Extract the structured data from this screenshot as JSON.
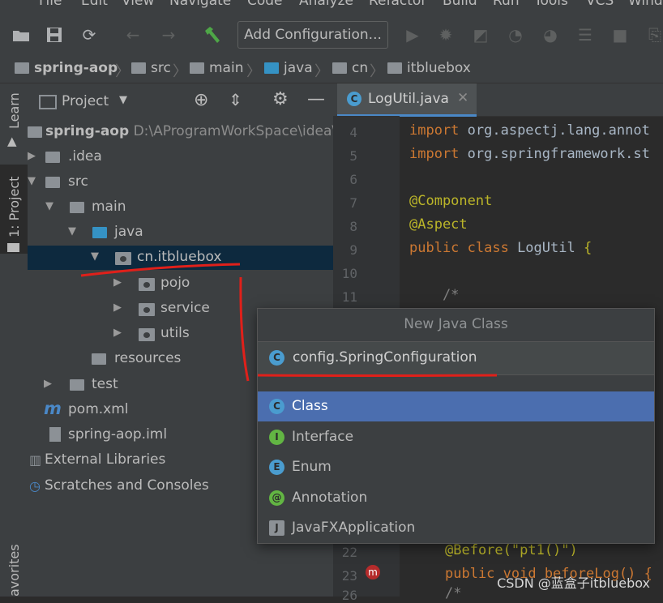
{
  "menu": [
    "File",
    "Edit",
    "View",
    "Navigate",
    "Code",
    "Analyze",
    "Refactor",
    "Build",
    "Run",
    "Tools",
    "VCS",
    "Wind"
  ],
  "toolbar": {
    "add_configuration": "Add Configuration..."
  },
  "breadcrumb": [
    "spring-aop",
    "src",
    "main",
    "java",
    "cn",
    "itbluebox"
  ],
  "stripe": {
    "learn": "Learn",
    "project": "1: Project",
    "favorites": "avorites"
  },
  "project_panel": {
    "title": "Project",
    "tree": [
      {
        "label": "spring-aop",
        "extra": "D:\\AProgramWorkSpace\\idea\\s"
      },
      {
        "label": ".idea"
      },
      {
        "label": "src"
      },
      {
        "label": "main"
      },
      {
        "label": "java"
      },
      {
        "label": "cn.itbluebox"
      },
      {
        "label": "pojo"
      },
      {
        "label": "service"
      },
      {
        "label": "utils"
      },
      {
        "label": "resources"
      },
      {
        "label": "test"
      },
      {
        "label": "pom.xml"
      },
      {
        "label": "spring-aop.iml"
      },
      {
        "label": "External Libraries"
      },
      {
        "label": "Scratches and Consoles"
      }
    ]
  },
  "editor": {
    "tab": "LogUtil.java",
    "lines": [
      {
        "n": "4",
        "parts": [
          [
            "kw",
            "import "
          ],
          [
            "pk",
            "org.aspectj.lang.annot"
          ]
        ]
      },
      {
        "n": "5",
        "parts": [
          [
            "kw",
            "import "
          ],
          [
            "pk",
            "org.springframework.st"
          ]
        ]
      },
      {
        "n": "6",
        "parts": []
      },
      {
        "n": "7",
        "parts": [
          [
            "ann",
            "@Component"
          ]
        ]
      },
      {
        "n": "8",
        "parts": [
          [
            "ann",
            "@Aspect"
          ]
        ]
      },
      {
        "n": "9",
        "parts": [
          [
            "kw",
            "public class "
          ],
          [
            "cls",
            "LogUtil "
          ],
          [
            "ann",
            "{"
          ]
        ]
      },
      {
        "n": "10",
        "parts": []
      },
      {
        "n": "11",
        "parts": [
          [
            "cmt",
            "    /*"
          ]
        ]
      }
    ],
    "bottom_lines": [
      {
        "n": "22",
        "text": "@Before(\"pt1()\")"
      },
      {
        "n": "23",
        "text": "public void beforeLog() {"
      },
      {
        "n": "26",
        "text": "/*"
      }
    ]
  },
  "popup": {
    "title": "New Java Class",
    "input_value": "config.SpringConfiguration",
    "kinds": [
      {
        "label": "Class",
        "badge": "C",
        "color": "#4a9ccf",
        "selected": true
      },
      {
        "label": "Interface",
        "badge": "I",
        "color": "#62b543"
      },
      {
        "label": "Enum",
        "badge": "E",
        "color": "#4a9ccf"
      },
      {
        "label": "Annotation",
        "badge": "@",
        "color": "#62b543"
      },
      {
        "label": "JavaFXApplication",
        "badge": "J",
        "color": "#8c9196"
      }
    ]
  },
  "watermark": "CSDN @蓝盒子itbluebox"
}
